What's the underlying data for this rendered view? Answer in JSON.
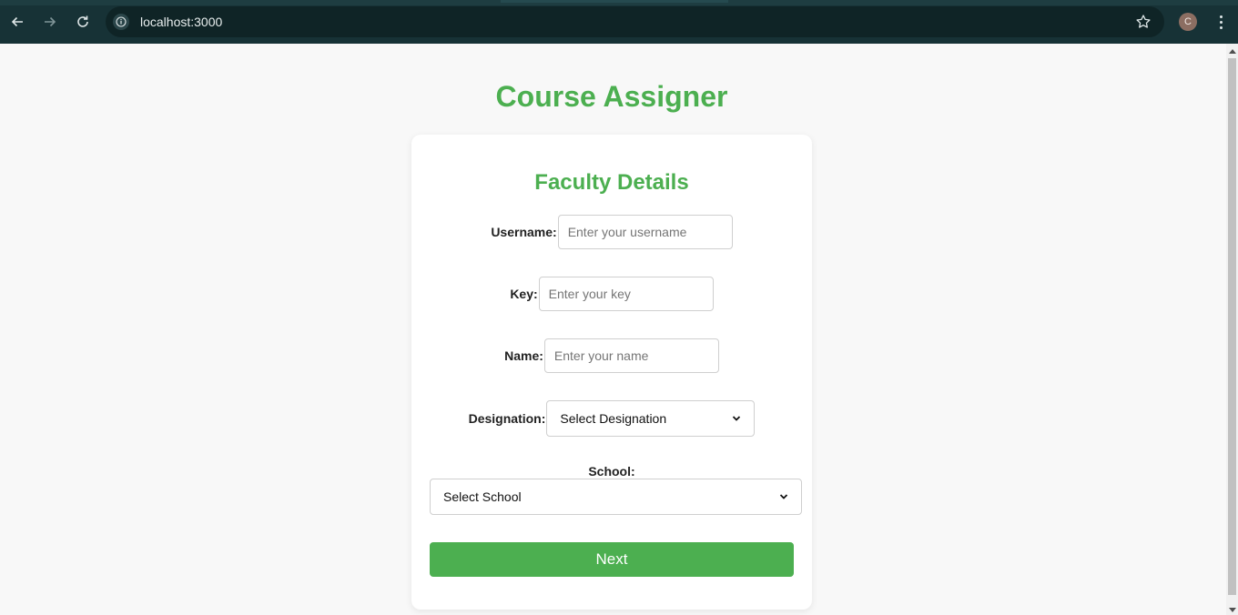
{
  "browser": {
    "url": "localhost:3000",
    "profile_initial": "C"
  },
  "page": {
    "title": "Course Assigner"
  },
  "form": {
    "title": "Faculty Details",
    "username": {
      "label": "Username:",
      "placeholder": "Enter your username"
    },
    "key": {
      "label": "Key:",
      "placeholder": "Enter your key"
    },
    "name": {
      "label": "Name:",
      "placeholder": "Enter your name"
    },
    "designation": {
      "label": "Designation:",
      "selected": "Select Designation"
    },
    "school": {
      "label": "School:",
      "selected": "Select School"
    },
    "next_label": "Next"
  },
  "colors": {
    "accent": "#4caf50",
    "chrome": "#173236"
  }
}
